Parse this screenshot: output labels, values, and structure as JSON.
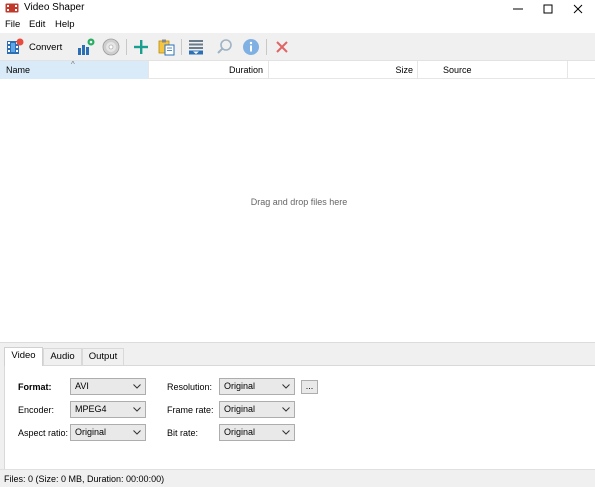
{
  "window": {
    "title": "Video Shaper",
    "controls": {
      "minimize": "—",
      "maximize": "☐",
      "close": "✕"
    }
  },
  "menu": [
    "File",
    "Edit",
    "Help"
  ],
  "toolbar": {
    "convert_label": "Convert",
    "buttons": [
      {
        "name": "convert",
        "icon": "film-convert-icon"
      },
      {
        "name": "batch",
        "icon": "bars-gear-icon"
      },
      {
        "name": "disc",
        "icon": "disc-icon"
      },
      {
        "name": "add",
        "icon": "plus-icon"
      },
      {
        "name": "paste",
        "icon": "clipboard-icon"
      },
      {
        "name": "move-down",
        "icon": "list-down-icon"
      },
      {
        "name": "search",
        "icon": "magnifier-icon"
      },
      {
        "name": "info",
        "icon": "info-icon"
      },
      {
        "name": "remove",
        "icon": "red-x-icon"
      }
    ]
  },
  "file_list": {
    "columns": [
      "Name",
      "Duration",
      "Size",
      "Source"
    ],
    "sort_indicator": "^",
    "empty_hint": "Drag and drop files here"
  },
  "tabs": [
    "Video",
    "Audio",
    "Output"
  ],
  "active_tab": "Video",
  "video_settings": {
    "format": {
      "label": "Format:",
      "value": "AVI"
    },
    "encoder": {
      "label": "Encoder:",
      "value": "MPEG4"
    },
    "aspect_ratio": {
      "label": "Aspect ratio:",
      "value": "Original"
    },
    "resolution": {
      "label": "Resolution:",
      "value": "Original"
    },
    "frame_rate": {
      "label": "Frame rate:",
      "value": "Original"
    },
    "bit_rate": {
      "label": "Bit rate:",
      "value": "Original"
    },
    "more_button": "..."
  },
  "status": "Files: 0 (Size: 0 MB, Duration: 00:00:00)",
  "colors": {
    "selected_header": "#d9ebf9",
    "toolbar_bg": "#f0f0f0",
    "add_icon": "#1a9e8f",
    "info_icon": "#4a90d9",
    "remove_icon": "#d9534f"
  }
}
